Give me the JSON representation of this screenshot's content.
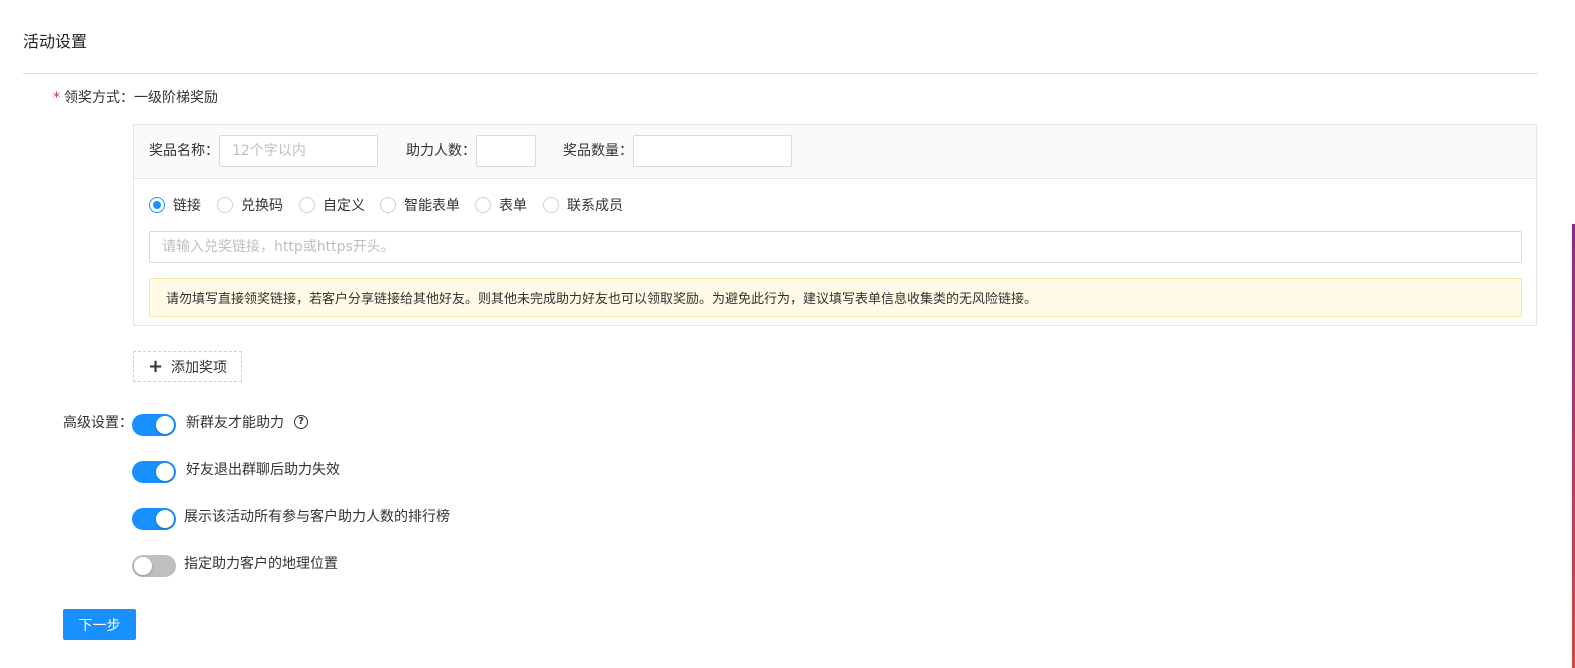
{
  "section": {
    "title": "活动设置"
  },
  "reward": {
    "label": "领奖方式：",
    "required_mark": "*",
    "value": "一级阶梯奖励"
  },
  "prize": {
    "name_label": "奖品名称：",
    "name_placeholder": "12个字以内",
    "name_value": "",
    "helpers_label": "助力人数：",
    "helpers_value": "",
    "quantity_label": "奖品数量：",
    "quantity_value": "",
    "types": [
      {
        "label": "链接",
        "checked": true
      },
      {
        "label": "兑换码",
        "checked": false
      },
      {
        "label": "自定义",
        "checked": false
      },
      {
        "label": "智能表单",
        "checked": false
      },
      {
        "label": "表单",
        "checked": false
      },
      {
        "label": "联系成员",
        "checked": false
      }
    ],
    "link_placeholder": "请输入兑奖链接，http或https开头。",
    "link_value": "",
    "warning": "请勿填写直接领奖链接，若客户分享链接给其他好友。则其他未完成助力好友也可以领取奖励。为避免此行为，建议填写表单信息收集类的无风险链接。"
  },
  "add_prize": {
    "icon": "plus-icon",
    "label": "添加奖项"
  },
  "advanced": {
    "label": "高级设置：",
    "options": [
      {
        "label": "新群友才能助力",
        "enabled": true,
        "help_icon": "question-circle-icon"
      },
      {
        "label": "好友退出群聊后助力失效",
        "enabled": true
      },
      {
        "label": "展示该活动所有参与客户助力人数的排行榜",
        "enabled": true
      },
      {
        "label": "指定助力客户的地理位置",
        "enabled": false
      }
    ]
  },
  "next_button": {
    "label": "下一步"
  },
  "colors": {
    "primary": "#1890ff",
    "required": "#f5222d",
    "warning_bg": "#fffbe6",
    "switch_off": "#bfbfbf"
  }
}
